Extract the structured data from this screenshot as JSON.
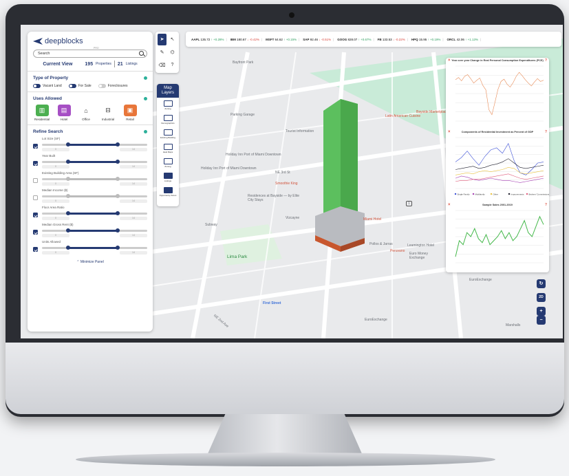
{
  "app": {
    "logo_text": "deepblocks",
    "logo_sub": "PRO"
  },
  "search": {
    "placeholder": "Search"
  },
  "current_view": {
    "label": "Current View",
    "properties_count": "195",
    "properties_label": "Properties",
    "listings_count": "21",
    "listings_label": "Listings"
  },
  "type_of_property": {
    "title": "Type of Property",
    "options": [
      {
        "label": "Vacant Land",
        "on": true
      },
      {
        "label": "For Sale",
        "on": true
      },
      {
        "label": "Foreclosures",
        "on": false
      }
    ]
  },
  "uses_allowed": {
    "title": "Uses Allowed",
    "items": [
      {
        "label": "Residential",
        "color": "#4caf50",
        "icon": "building-icon"
      },
      {
        "label": "Hotel",
        "color": "#a64fc4",
        "icon": "hotel-icon"
      },
      {
        "label": "Office",
        "color": "#ffffff",
        "icon": "office-icon"
      },
      {
        "label": "Industrial",
        "color": "#ffffff",
        "icon": "factory-icon"
      },
      {
        "label": "Retail",
        "color": "#e8763a",
        "icon": "shop-icon"
      }
    ]
  },
  "refine_search": {
    "title": "Refine Search",
    "filters": [
      {
        "label": "Lot Size (SF)",
        "checked": true,
        "min": "0",
        "max": "14"
      },
      {
        "label": "Year Built",
        "checked": true,
        "min": "0",
        "max": "14"
      },
      {
        "label": "Existing Building Area (SF)",
        "checked": false,
        "min": "0",
        "max": "14"
      },
      {
        "label": "Median Income ($)",
        "checked": false,
        "min": "0",
        "max": "14"
      },
      {
        "label": "Floor Area Ratio",
        "checked": true,
        "min": "0",
        "max": "14"
      },
      {
        "label": "Median Gross Rent ($)",
        "checked": true,
        "min": "0",
        "max": "14"
      },
      {
        "label": "Units Allowed",
        "checked": true,
        "min": "0",
        "max": "14"
      }
    ]
  },
  "minimize_label": "Minimize Panel",
  "map_layers": {
    "title_line1": "Map",
    "title_line2": "Layers",
    "items": [
      "Zoning",
      "Demographics",
      "Existing Building",
      "Heat Maps",
      "Zoning",
      "Listings",
      "Opportunity Zones"
    ]
  },
  "ticker": [
    {
      "sym": "AAPL",
      "price": "135.72",
      "dir": "up",
      "chg": "+0.28%"
    },
    {
      "sym": "IBM",
      "price": "180.67",
      "dir": "dn",
      "chg": "-0.42%"
    },
    {
      "sym": "MSFT",
      "price": "64.62",
      "dir": "up",
      "chg": "+0.15%"
    },
    {
      "sym": "SAP",
      "price": "92.46",
      "dir": "dn",
      "chg": "-0.51%"
    },
    {
      "sym": "GOOG",
      "price": "828.07",
      "dir": "up",
      "chg": "+0.67%"
    },
    {
      "sym": "FB",
      "price": "133.53",
      "dir": "dn",
      "chg": "-0.22%"
    },
    {
      "sym": "HPQ",
      "price": "15.95",
      "dir": "up",
      "chg": "+0.19%"
    },
    {
      "sym": "ORCL",
      "price": "42.06",
      "dir": "up",
      "chg": "+1.13%"
    }
  ],
  "map_labels": {
    "bayfront": "Bayfront Park",
    "parking": "Parking Garage",
    "holiday1": "Holiday Inn Port of Miami Downtown",
    "holiday2": "Holiday Inn Port of Miami Downtown",
    "smoothie": "Smoothie King",
    "residences": "Residences at Bayside — by Elite City Stays",
    "subway": "Subway",
    "lima": "Lima Park",
    "first_street": "First Street",
    "miami_hotel": "Miami Hotel",
    "pollos": "Pollos & Jarras",
    "leamington": "Leamington Hotel",
    "peruvano": "Peruvano",
    "euro_money": "Euro Money Exchange",
    "euroexchange1": "EuroExchange",
    "euroexchange2": "EuroExchange",
    "marshalls": "Marshalls",
    "latin": "Latin American Cuisine",
    "bayside": "Bayside Marketplace",
    "tourist": "Tourist Information",
    "vizcayne": "Vizcayne",
    "ne3rd": "NE 3rd St",
    "ne2nd": "NE 2nd Ave",
    "metro": "1"
  },
  "map_controls": {
    "rotate": "↻",
    "mode": "2D",
    "zoom_in": "+",
    "zoom_out": "−"
  },
  "chart_data": [
    {
      "type": "line",
      "title": "Year over year Change in Real Personal Consumption Expenditures (PCE)",
      "series": [
        {
          "values": [
            3.2,
            3.6,
            3.0,
            3.8,
            4.1,
            3.4,
            2.6,
            3.1,
            3.5,
            2.2,
            1.4,
            -2.1,
            -3.0,
            -0.8,
            1.5,
            2.9,
            3.3,
            2.4,
            1.9,
            2.7,
            3.8,
            4.5,
            3.9,
            3.2,
            2.6,
            2.1,
            2.8,
            3.4,
            2.9,
            3.1
          ]
        }
      ],
      "color": "#e88a55"
    },
    {
      "type": "line",
      "title": "Components of Residential Investment as Percent of GDP",
      "series": [
        {
          "name": "Single Family",
          "values": [
            2.1,
            2.5,
            3.1,
            2.4,
            1.8,
            2.6,
            3.2,
            3.4,
            2.9,
            3.8,
            2.2,
            1.1,
            0.9,
            1.4,
            2.0,
            2.1
          ]
        },
        {
          "name": "Multifamily",
          "values": [
            0.6,
            0.8,
            0.7,
            0.5,
            0.4,
            0.5,
            0.6,
            0.5,
            0.4,
            0.4,
            0.3,
            0.2,
            0.3,
            0.4,
            0.5,
            0.6
          ]
        },
        {
          "name": "Other",
          "values": [
            0.9,
            1.0,
            1.1,
            1.0,
            1.2,
            1.3,
            1.2,
            1.3,
            1.4,
            1.6,
            1.5,
            1.1,
            1.0,
            1.1,
            1.2,
            1.3
          ]
        },
        {
          "name": "Improvements",
          "values": [
            1.4,
            1.5,
            1.6,
            1.7,
            1.5,
            1.6,
            1.8,
            1.9,
            2.1,
            2.4,
            2.0,
            1.6,
            1.5,
            1.6,
            1.7,
            1.8
          ]
        },
        {
          "name": "Brokers' Commissions",
          "values": [
            0.3,
            0.4,
            0.4,
            0.5,
            0.5,
            0.6,
            0.7,
            0.8,
            0.9,
            1.0,
            0.8,
            0.6,
            0.5,
            0.6,
            0.7,
            0.8
          ]
        }
      ],
      "legend": [
        "Single Family",
        "Multifamily",
        "Other",
        "Improvements",
        "Brokers' Commissions"
      ],
      "colors": [
        "#3b4fd6",
        "#a63fb3",
        "#e9c240",
        "#1c1c2a",
        "#e05a7a"
      ]
    },
    {
      "type": "line",
      "title": "Sample Sales 2001-2019",
      "series": [
        {
          "values": [
            52,
            60,
            58,
            64,
            62,
            66,
            61,
            59,
            63,
            58,
            60,
            62,
            65,
            61,
            64,
            60,
            62,
            66,
            70,
            64,
            62,
            67,
            72,
            68
          ]
        }
      ],
      "color": "#44b84a"
    }
  ]
}
